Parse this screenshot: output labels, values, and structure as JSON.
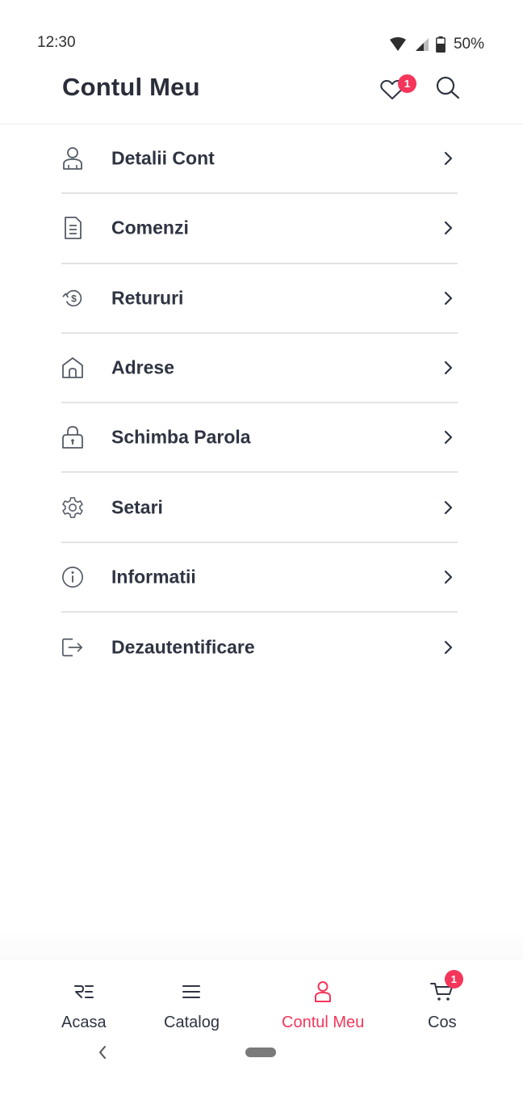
{
  "status_bar": {
    "time": "12:30",
    "battery": "50%",
    "icons": [
      "wifi-icon",
      "cell-signal-icon",
      "battery-icon"
    ]
  },
  "header": {
    "title": "Contul Meu",
    "favorites_badge": "1",
    "icons": [
      "heart-icon",
      "search-icon"
    ]
  },
  "menu": {
    "items": [
      {
        "label": "Detalii Cont",
        "icon": "user-icon"
      },
      {
        "label": "Comenzi",
        "icon": "document-icon"
      },
      {
        "label": "Retururi",
        "icon": "refund-icon"
      },
      {
        "label": "Adrese",
        "icon": "home-icon"
      },
      {
        "label": "Schimba Parola",
        "icon": "lock-icon"
      },
      {
        "label": "Setari",
        "icon": "gear-icon"
      },
      {
        "label": "Informatii",
        "icon": "info-icon"
      },
      {
        "label": "Dezautentificare",
        "icon": "logout-icon"
      }
    ]
  },
  "bottom_nav": {
    "items": [
      {
        "label": "Acasa",
        "icon": "logo-icon",
        "active": false
      },
      {
        "label": "Catalog",
        "icon": "menu-lines-icon",
        "active": false
      },
      {
        "label": "Contul Meu",
        "icon": "user-icon",
        "active": true
      },
      {
        "label": "Cos",
        "icon": "cart-icon",
        "active": false
      }
    ],
    "cart_badge": "1"
  },
  "colors": {
    "accent": "#f4365b",
    "text": "#2f3442",
    "icon": "#555b66",
    "divider": "#e3e3e3"
  }
}
